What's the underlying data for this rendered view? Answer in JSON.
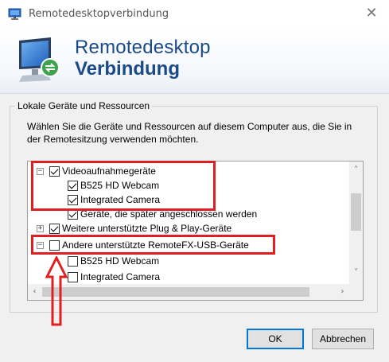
{
  "window": {
    "title": "Remotedesktopverbindung",
    "close_glyph": "✕",
    "app_icon": "remote-desktop-icon"
  },
  "banner": {
    "line1": "Remotedesktop",
    "line2": "Verbindung",
    "logo_icon": "monitor-remote-icon"
  },
  "group": {
    "label": "Lokale Geräte und Ressourcen",
    "description": "Wählen Sie die Geräte und Ressourcen auf diesem Computer aus, die Sie in der Remotesitzung verwenden möchten."
  },
  "tree": {
    "items": [
      {
        "label": "Videoaufnahmegeräte",
        "checked": true,
        "expander": "⊟"
      },
      {
        "label": "B525 HD Webcam",
        "checked": true
      },
      {
        "label": "Integrated Camera",
        "checked": true
      },
      {
        "label": "Geräte, die später angeschlossen werden",
        "checked": true
      },
      {
        "label": "Weitere unterstützte Plug & Play-Geräte",
        "checked": true,
        "expander": "+"
      },
      {
        "label": "Andere unterstützte RemoteFX-USB-Geräte",
        "checked": false,
        "expander": "⊟"
      },
      {
        "label": "B525 HD Webcam",
        "checked": false
      },
      {
        "label": "Integrated Camera",
        "checked": false
      }
    ]
  },
  "scrollbars": {
    "up": "˄",
    "down": "˅",
    "left": "‹",
    "right": "›"
  },
  "buttons": {
    "ok": "OK",
    "cancel": "Abbrechen"
  },
  "colors": {
    "accent": "#1a4a8a",
    "highlight": "#e02020",
    "default_button_border": "#0078d7"
  }
}
